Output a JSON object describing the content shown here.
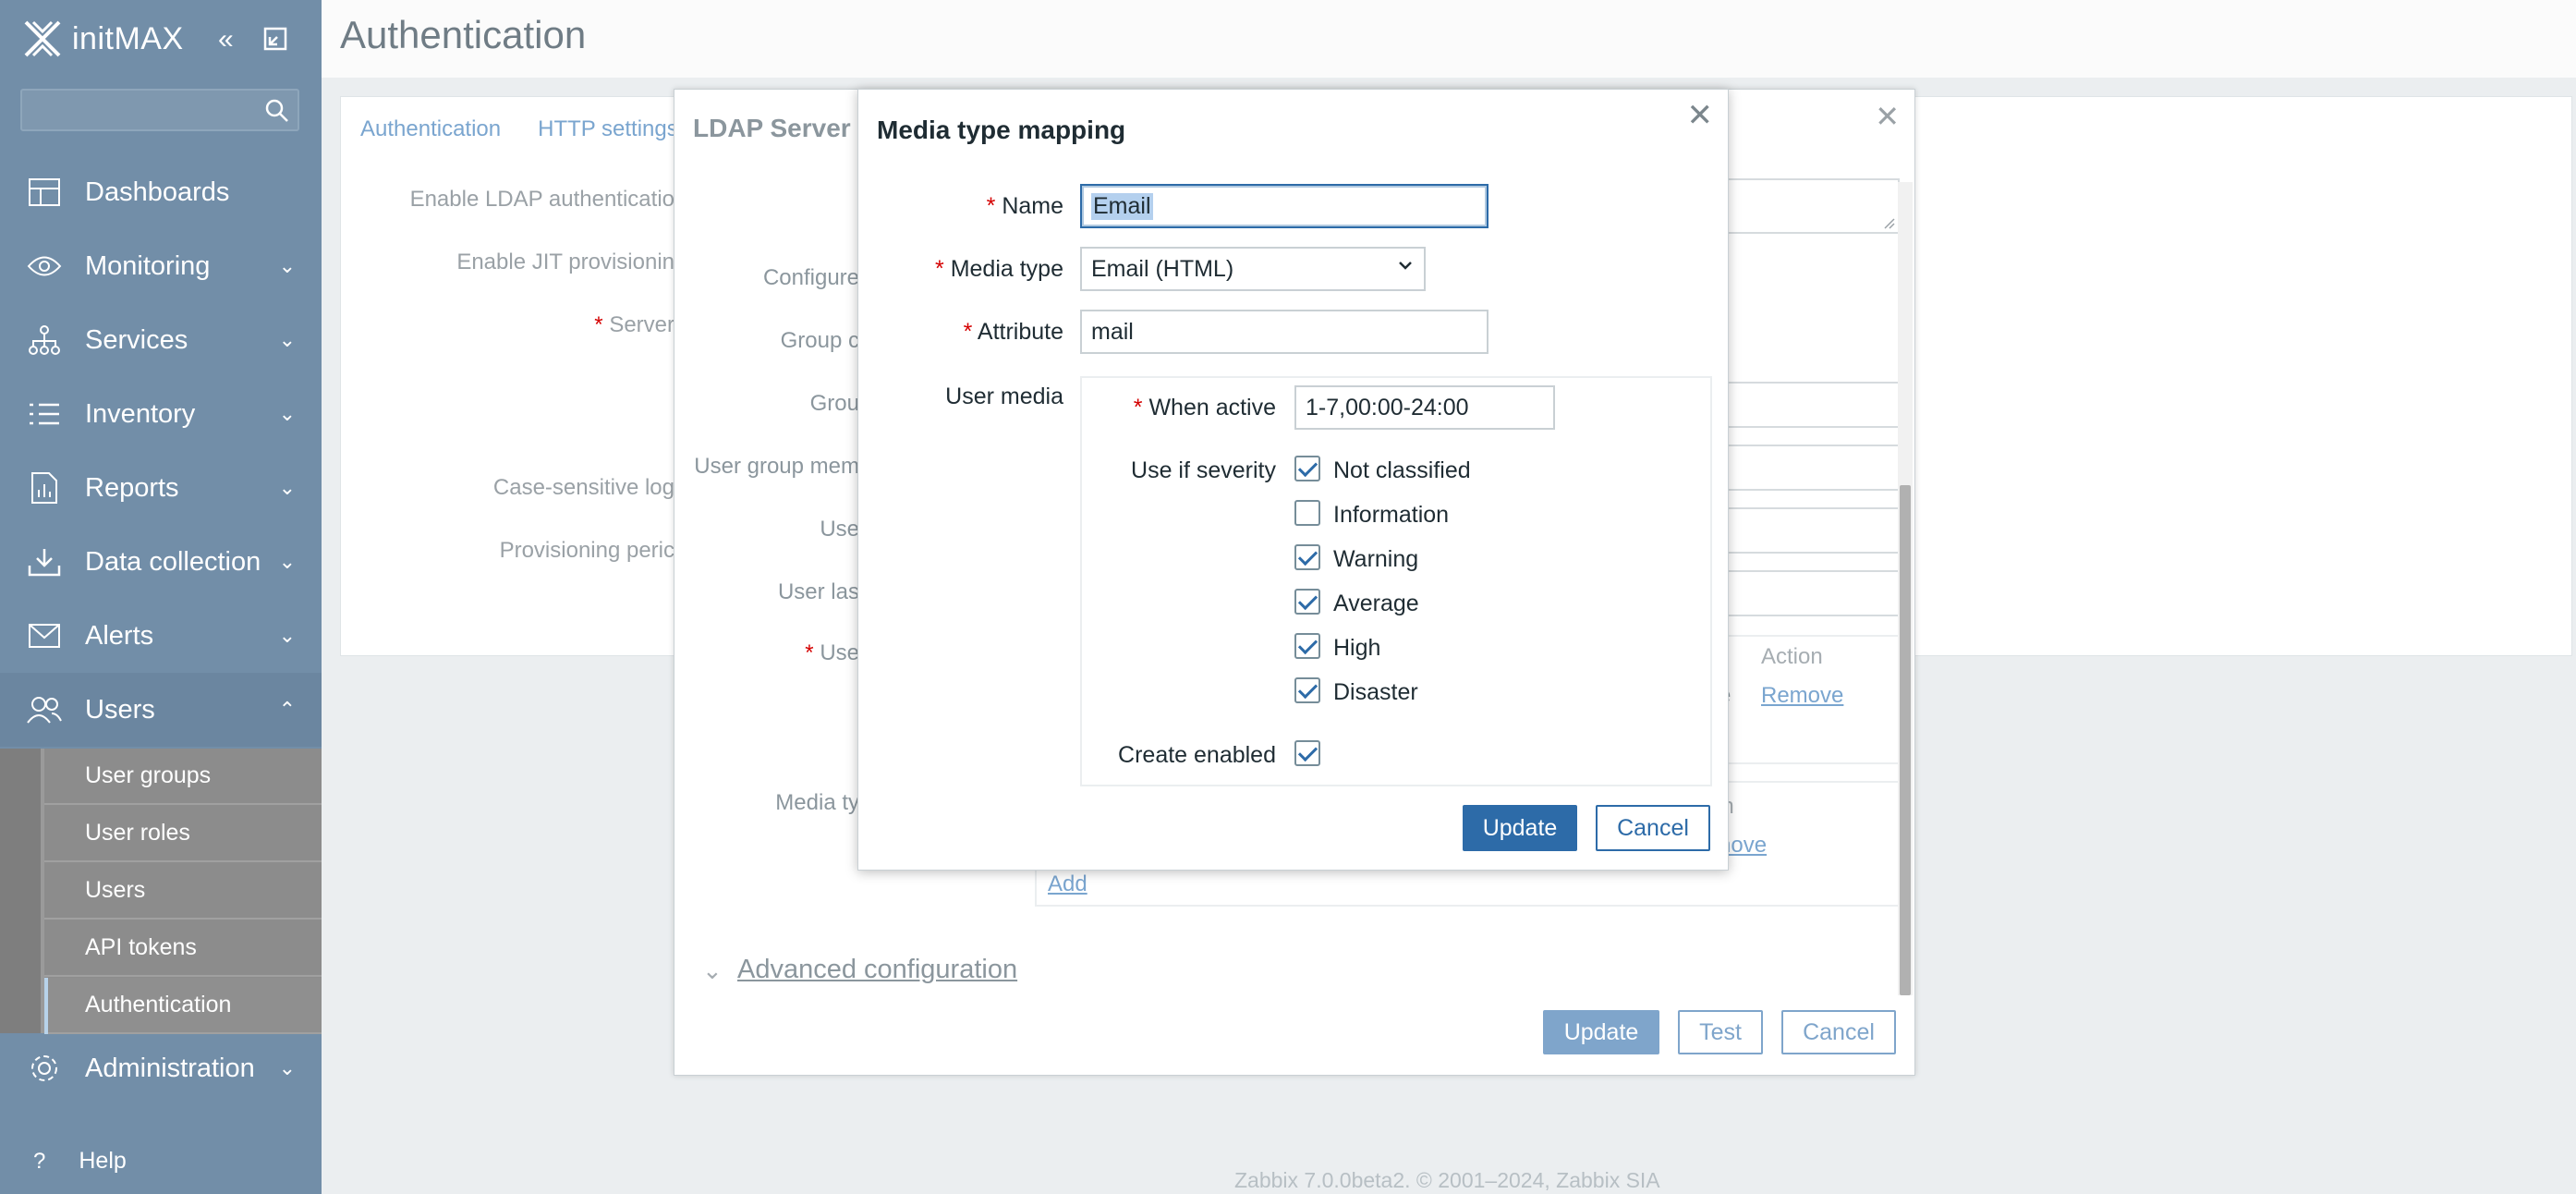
{
  "sidebar": {
    "brand": "initMAX",
    "search_placeholder": "",
    "nav": [
      {
        "label": "Dashboards",
        "icon": "dashboards-icon",
        "has_chevron": false
      },
      {
        "label": "Monitoring",
        "icon": "monitoring-icon",
        "has_chevron": true
      },
      {
        "label": "Services",
        "icon": "services-icon",
        "has_chevron": true
      },
      {
        "label": "Inventory",
        "icon": "inventory-icon",
        "has_chevron": true
      },
      {
        "label": "Reports",
        "icon": "reports-icon",
        "has_chevron": true
      },
      {
        "label": "Data collection",
        "icon": "data-collection-icon",
        "has_chevron": true
      },
      {
        "label": "Alerts",
        "icon": "alerts-icon",
        "has_chevron": true
      },
      {
        "label": "Users",
        "icon": "users-icon",
        "has_chevron": true
      },
      {
        "label": "Administration",
        "icon": "administration-icon",
        "has_chevron": true
      }
    ],
    "users_sub": [
      "User groups",
      "User roles",
      "Users",
      "API tokens",
      "Authentication"
    ],
    "help": "Help"
  },
  "page": {
    "title": "Authentication",
    "tabs": [
      "Authentication",
      "HTTP settings"
    ],
    "bg_labels": [
      "Enable LDAP authenticatio",
      "Enable JIT provisionin",
      "Server",
      "Case-sensitive log",
      "Provisioning peric"
    ],
    "footer": "Zabbix 7.0.0beta2. © 2001–2024, Zabbix SIA"
  },
  "ldap": {
    "title": "LDAP Server",
    "labels": [
      "Configure",
      "Group c",
      "Grou",
      "User group mem",
      "Use",
      "User las",
      "Use",
      "Media ty"
    ],
    "th_action": "Action",
    "remove_link": "Remove",
    "remove_link2": "nove",
    "col_fragment_e": "e",
    "col_fragment_on": "on",
    "add_link": "Add",
    "advanced": "Advanced configuration",
    "btn_update": "Update",
    "btn_test": "Test",
    "btn_cancel": "Cancel"
  },
  "mtm": {
    "title": "Media type mapping",
    "name_label": "Name",
    "name_value": "Email",
    "media_type_label": "Media type",
    "media_type_value": "Email (HTML)",
    "attribute_label": "Attribute",
    "attribute_value": "mail",
    "user_media_label": "User media",
    "when_active_label": "When active",
    "when_active_value": "1-7,00:00-24:00",
    "severity_label": "Use if severity",
    "severities": [
      {
        "label": "Not classified",
        "checked": true
      },
      {
        "label": "Information",
        "checked": false
      },
      {
        "label": "Warning",
        "checked": true
      },
      {
        "label": "Average",
        "checked": true
      },
      {
        "label": "High",
        "checked": true
      },
      {
        "label": "Disaster",
        "checked": true
      }
    ],
    "create_enabled_label": "Create enabled",
    "create_enabled": true,
    "btn_update": "Update",
    "btn_cancel": "Cancel"
  }
}
